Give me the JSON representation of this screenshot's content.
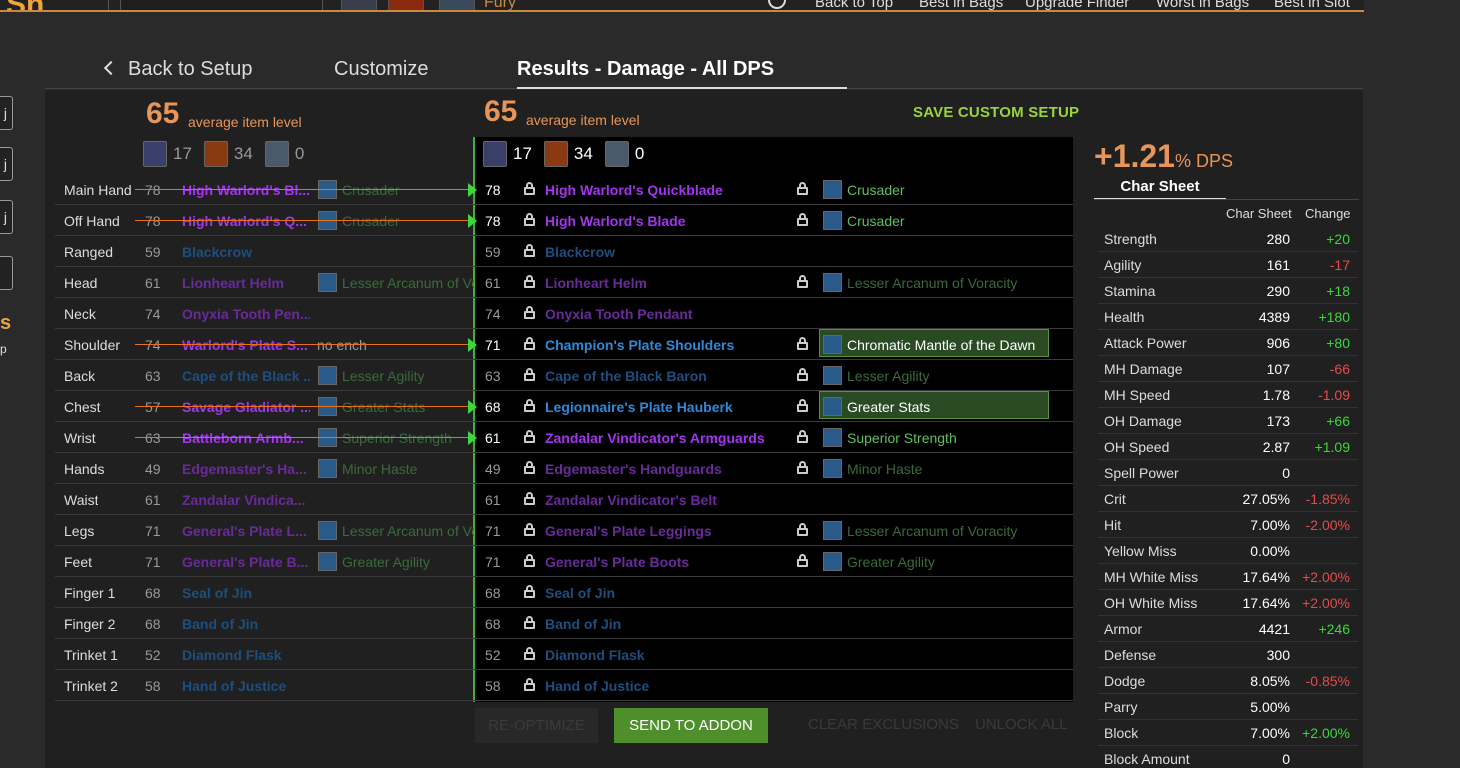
{
  "header": {
    "logo": "Sh",
    "spec_name": "Fury",
    "links": [
      "Back to Top",
      "Best in Bags",
      "Upgrade Finder",
      "Worst in Bags",
      "Best in Slot"
    ]
  },
  "left_rail": {
    "buttons": [
      "j",
      "j",
      "j"
    ],
    "text1": "s",
    "text2": "p"
  },
  "tabs": {
    "back": "Back to Setup",
    "customize": "Customize",
    "results": "Results - Damage - All DPS"
  },
  "current": {
    "avg_ilvl": "65",
    "avg_label": "average item level",
    "counts": [
      "17",
      "34",
      "0"
    ]
  },
  "optimized": {
    "avg_ilvl": "65",
    "avg_label": "average item level",
    "counts": [
      "17",
      "34",
      "0"
    ]
  },
  "save_custom": "SAVE CUSTOM SETUP",
  "rows": [
    {
      "slot": "Main Hand",
      "cur_lv": "78",
      "cur_item": "High Warlord's Bl...",
      "cur_q": "q-epic",
      "cur_ench": "Crusader",
      "changed": true,
      "new_lv": "78",
      "new_item": "High Warlord's Quickblade",
      "new_q": "q-epic",
      "new_ench": "Crusader",
      "ench_lock": true,
      "ench_highlight": false,
      "item_dim": false
    },
    {
      "slot": "Off Hand",
      "cur_lv": "78",
      "cur_item": "High Warlord's Q...",
      "cur_q": "q-epic",
      "cur_ench": "Crusader",
      "changed": true,
      "new_lv": "78",
      "new_item": "High Warlord's Blade",
      "new_q": "q-epic",
      "new_ench": "Crusader",
      "ench_lock": true,
      "ench_highlight": false,
      "item_dim": false
    },
    {
      "slot": "Ranged",
      "cur_lv": "59",
      "cur_item": "Blackcrow",
      "cur_q": "q-rare-dim",
      "cur_ench": "",
      "changed": false,
      "new_lv": "59",
      "new_item": "Blackcrow",
      "new_q": "q-rare-dim",
      "new_ench": "",
      "ench_lock": false,
      "ench_highlight": false
    },
    {
      "slot": "Head",
      "cur_lv": "61",
      "cur_item": "Lionheart Helm",
      "cur_q": "q-epic-dim",
      "cur_ench": "Lesser Arcanum of Vo",
      "changed": false,
      "new_lv": "61",
      "new_item": "Lionheart Helm",
      "new_q": "q-epic-dim",
      "new_ench": "Lesser Arcanum of Voracity",
      "ench_lock": true,
      "ench_highlight": false
    },
    {
      "slot": "Neck",
      "cur_lv": "74",
      "cur_item": "Onyxia Tooth Pen...",
      "cur_q": "q-epic-dim",
      "cur_ench": "",
      "changed": false,
      "new_lv": "74",
      "new_item": "Onyxia Tooth Pendant",
      "new_q": "q-epic-dim",
      "new_ench": "",
      "ench_lock": false,
      "ench_highlight": false
    },
    {
      "slot": "Shoulder",
      "cur_lv": "74",
      "cur_item": "Warlord's Plate S...",
      "cur_q": "q-epic",
      "cur_ench": "no ench",
      "changed": true,
      "new_lv": "71",
      "new_item": "Champion's Plate Shoulders",
      "new_q": "q-rare",
      "new_ench": "Chromatic Mantle of the Dawn",
      "ench_lock": true,
      "ench_highlight": true
    },
    {
      "slot": "Back",
      "cur_lv": "63",
      "cur_item": "Cape of the Black ...",
      "cur_q": "q-rare-dim",
      "cur_ench": "Lesser Agility",
      "changed": false,
      "new_lv": "63",
      "new_item": "Cape of the Black Baron",
      "new_q": "q-rare-dim",
      "new_ench": "Lesser Agility",
      "ench_lock": true,
      "ench_highlight": false
    },
    {
      "slot": "Chest",
      "cur_lv": "57",
      "cur_item": "Savage Gladiator ...",
      "cur_q": "q-epic",
      "cur_ench": "Greater Stats",
      "changed": true,
      "new_lv": "68",
      "new_item": "Legionnaire's Plate Hauberk",
      "new_q": "q-rare",
      "new_ench": "Greater Stats",
      "ench_lock": true,
      "ench_highlight": true
    },
    {
      "slot": "Wrist",
      "cur_lv": "63",
      "cur_item": "Battleborn Armb...",
      "cur_q": "q-epic",
      "cur_ench": "Superior Strength",
      "changed": true,
      "new_lv": "61",
      "new_item": "Zandalar Vindicator's Armguards",
      "new_q": "q-epic",
      "new_ench": "Superior Strength",
      "ench_lock": true,
      "ench_highlight": false
    },
    {
      "slot": "Hands",
      "cur_lv": "49",
      "cur_item": "Edgemaster's Ha...",
      "cur_q": "q-epic-dim",
      "cur_ench": "Minor Haste",
      "changed": false,
      "new_lv": "49",
      "new_item": "Edgemaster's Handguards",
      "new_q": "q-epic-dim",
      "new_ench": "Minor Haste",
      "ench_lock": true,
      "ench_highlight": false
    },
    {
      "slot": "Waist",
      "cur_lv": "61",
      "cur_item": "Zandalar Vindica...",
      "cur_q": "q-epic-dim",
      "cur_ench": "",
      "changed": false,
      "new_lv": "61",
      "new_item": "Zandalar Vindicator's Belt",
      "new_q": "q-epic-dim",
      "new_ench": "",
      "ench_lock": false,
      "ench_highlight": false
    },
    {
      "slot": "Legs",
      "cur_lv": "71",
      "cur_item": "General's Plate L...",
      "cur_q": "q-epic-dim",
      "cur_ench": "Lesser Arcanum of Vo",
      "changed": false,
      "new_lv": "71",
      "new_item": "General's Plate Leggings",
      "new_q": "q-epic-dim",
      "new_ench": "Lesser Arcanum of Voracity",
      "ench_lock": true,
      "ench_highlight": false
    },
    {
      "slot": "Feet",
      "cur_lv": "71",
      "cur_item": "General's Plate B...",
      "cur_q": "q-epic-dim",
      "cur_ench": "Greater Agility",
      "changed": false,
      "new_lv": "71",
      "new_item": "General's Plate Boots",
      "new_q": "q-epic-dim",
      "new_ench": "Greater Agility",
      "ench_lock": true,
      "ench_highlight": false
    },
    {
      "slot": "Finger 1",
      "cur_lv": "68",
      "cur_item": "Seal of Jin",
      "cur_q": "q-rare-dim",
      "cur_ench": "",
      "changed": false,
      "new_lv": "68",
      "new_item": "Seal of Jin",
      "new_q": "q-rare-dim",
      "new_ench": "",
      "ench_lock": false,
      "ench_highlight": false
    },
    {
      "slot": "Finger 2",
      "cur_lv": "68",
      "cur_item": "Band of Jin",
      "cur_q": "q-rare-dim",
      "cur_ench": "",
      "changed": false,
      "new_lv": "68",
      "new_item": "Band of Jin",
      "new_q": "q-rare-dim",
      "new_ench": "",
      "ench_lock": false,
      "ench_highlight": false
    },
    {
      "slot": "Trinket 1",
      "cur_lv": "52",
      "cur_item": "Diamond Flask",
      "cur_q": "q-rare-dim",
      "cur_ench": "",
      "changed": false,
      "new_lv": "52",
      "new_item": "Diamond Flask",
      "new_q": "q-rare-dim",
      "new_ench": "",
      "ench_lock": false,
      "ench_highlight": false
    },
    {
      "slot": "Trinket 2",
      "cur_lv": "58",
      "cur_item": "Hand of Justice",
      "cur_q": "q-rare-dim",
      "cur_ench": "",
      "changed": false,
      "new_lv": "58",
      "new_item": "Hand of Justice",
      "new_q": "q-rare-dim",
      "new_ench": "",
      "ench_lock": false,
      "ench_highlight": false
    }
  ],
  "buttons": {
    "reoptimize": "RE-OPTIMIZE",
    "send_addon": "SEND TO ADDON",
    "clear_excl": "CLEAR EXCLUSIONS",
    "unlock_all": "UNLOCK ALL"
  },
  "dps": {
    "value": "+1.21",
    "unit": "% DPS"
  },
  "char_sheet": {
    "tab": "Char Sheet",
    "col1": "Char Sheet",
    "col2": "Change",
    "stats": [
      {
        "name": "Strength",
        "value": "280",
        "change": "+20",
        "dir": "pos"
      },
      {
        "name": "Agility",
        "value": "161",
        "change": "-17",
        "dir": "neg"
      },
      {
        "name": "Stamina",
        "value": "290",
        "change": "+18",
        "dir": "pos"
      },
      {
        "name": "Health",
        "value": "4389",
        "change": "+180",
        "dir": "pos"
      },
      {
        "name": "Attack Power",
        "value": "906",
        "change": "+80",
        "dir": "pos"
      },
      {
        "name": "MH Damage",
        "value": "107",
        "change": "-66",
        "dir": "neg"
      },
      {
        "name": "MH Speed",
        "value": "1.78",
        "change": "-1.09",
        "dir": "neg"
      },
      {
        "name": "OH Damage",
        "value": "173",
        "change": "+66",
        "dir": "pos"
      },
      {
        "name": "OH Speed",
        "value": "2.87",
        "change": "+1.09",
        "dir": "pos"
      },
      {
        "name": "Spell Power",
        "value": "0",
        "change": "",
        "dir": "pos"
      },
      {
        "name": "Crit",
        "value": "27.05%",
        "change": "-1.85%",
        "dir": "neg"
      },
      {
        "name": "Hit",
        "value": "7.00%",
        "change": "-2.00%",
        "dir": "neg"
      },
      {
        "name": "Yellow Miss",
        "value": "0.00%",
        "change": "",
        "dir": "pos"
      },
      {
        "name": "MH White Miss",
        "value": "17.64%",
        "change": "+2.00%",
        "dir": "neg"
      },
      {
        "name": "OH White Miss",
        "value": "17.64%",
        "change": "+2.00%",
        "dir": "neg"
      },
      {
        "name": "Armor",
        "value": "4421",
        "change": "+246",
        "dir": "pos"
      },
      {
        "name": "Defense",
        "value": "300",
        "change": "",
        "dir": "pos"
      },
      {
        "name": "Dodge",
        "value": "8.05%",
        "change": "-0.85%",
        "dir": "neg"
      },
      {
        "name": "Parry",
        "value": "5.00%",
        "change": "",
        "dir": "pos"
      },
      {
        "name": "Block",
        "value": "7.00%",
        "change": "+2.00%",
        "dir": "pos"
      },
      {
        "name": "Block Amount",
        "value": "0",
        "change": "",
        "dir": "pos"
      }
    ]
  }
}
